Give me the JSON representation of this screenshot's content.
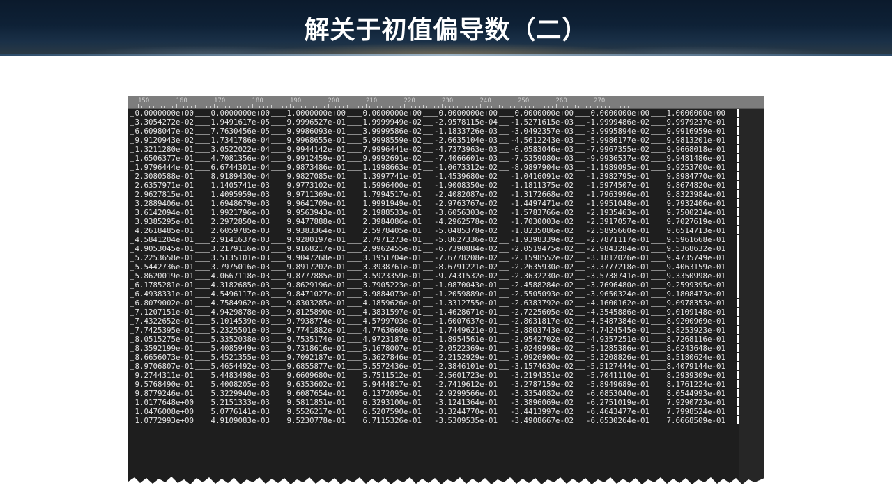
{
  "slide": {
    "title": "解关于初值偏导数（二）"
  },
  "ruler": {
    "ticks": [
      "150",
      "160",
      "170",
      "180",
      "190",
      "200",
      "210",
      "220",
      "230",
      "240",
      "250",
      "260",
      "270"
    ]
  },
  "editor": {
    "rows": [
      [
        "0.0000000e+00",
        "0.0000000e+00",
        "1.0000000e+00",
        "0.0000000e+00",
        "0.0000000e+00",
        "0.0000000e+00",
        "0.0000000e+00",
        "1.0000000e+00"
      ],
      [
        "3.3054272e-02",
        "1.9491617e-05",
        "9.9996527e-01",
        "1.9999949e-02",
        "-2.9578115e-04",
        "-1.5271615e-03",
        "-1.9999486e-02",
        "9.9979237e-01"
      ],
      [
        "6.6098047e-02",
        "7.7630456e-05",
        "9.9986093e-01",
        "3.9999586e-02",
        "-1.1833726e-03",
        "-3.0492357e-03",
        "-3.9995894e-02",
        "9.9916959e-01"
      ],
      [
        "9.9120943e-02",
        "1.7341786e-04",
        "9.9968655e-01",
        "5.9998559e-02",
        "-2.6635104e-03",
        "-4.5612243e-03",
        "-5.9986177e-02",
        "9.9813201e-01"
      ],
      [
        "1.3211280e-01",
        "3.0522022e-04",
        "9.9944142e-01",
        "7.9996441e-02",
        "-4.7373963e-03",
        "-6.0583046e-03",
        "-7.9967355e-02",
        "9.9668018e-01"
      ],
      [
        "1.6506377e-01",
        "4.7081356e-04",
        "9.9912459e-01",
        "9.9992691e-02",
        "-7.4066601e-03",
        "-7.5359080e-03",
        "-9.9936537e-02",
        "9.9481486e-01"
      ],
      [
        "1.9796444e-01",
        "6.6744301e-04",
        "9.9873486e-01",
        "1.1998663e-01",
        "-1.0673312e-02",
        "-8.9897904e-03",
        "-1.1989095e-01",
        "9.9253700e-01"
      ],
      [
        "2.3080588e-01",
        "8.9189430e-04",
        "9.9827085e-01",
        "1.3997741e-01",
        "-1.4539680e-02",
        "-1.0416091e-02",
        "-1.3982795e-01",
        "9.8984770e-01"
      ],
      [
        "2.6357971e-01",
        "1.1405741e-03",
        "9.9773102e-01",
        "1.5996400e-01",
        "-1.9008350e-02",
        "-1.1811375e-02",
        "-1.5974507e-01",
        "9.8674820e-01"
      ],
      [
        "2.9627815e-01",
        "1.4095959e-03",
        "9.9711369e-01",
        "1.7994517e-01",
        "-2.4082087e-02",
        "-1.3172668e-02",
        "-1.7963996e-01",
        "9.8323984e-01"
      ],
      [
        "3.2889406e-01",
        "1.6948679e-03",
        "9.9641709e-01",
        "1.9991949e-01",
        "-2.9763767e-02",
        "-1.4497471e-02",
        "-1.9951048e-01",
        "9.7932406e-01"
      ],
      [
        "3.6142094e-01",
        "1.9921796e-03",
        "9.9563943e-01",
        "2.1988533e-01",
        "-3.6056303e-02",
        "-1.5783766e-02",
        "-2.1935463e-01",
        "9.7500234e-01"
      ],
      [
        "3.9385295e-01",
        "2.2972850e-03",
        "9.9477888e-01",
        "2.3984086e-01",
        "-4.2962578e-02",
        "-1.7030003e-02",
        "-2.3917057e-01",
        "9.7027619e-01"
      ],
      [
        "4.2618485e-01",
        "2.6059785e-03",
        "9.9383364e-01",
        "2.5978405e-01",
        "-5.0485378e-02",
        "-1.8235086e-02",
        "-2.5895660e-01",
        "9.6514713e-01"
      ],
      [
        "4.5841204e-01",
        "2.9141637e-03",
        "9.9280197e-01",
        "2.7971273e-01",
        "-5.8627336e-02",
        "-1.9398339e-02",
        "-2.7871117e-01",
        "9.5961668e-01"
      ],
      [
        "4.9053045e-01",
        "3.2179116e-03",
        "9.9168217e-01",
        "2.9962455e-01",
        "-6.7390884e-02",
        "-2.0519475e-02",
        "-2.9843284e-01",
        "9.5368632e-01"
      ],
      [
        "5.2253658e-01",
        "3.5135101e-03",
        "9.9047268e-01",
        "3.1951704e-01",
        "-7.6778208e-02",
        "-2.1598552e-02",
        "-3.1812026e-01",
        "9.4735749e-01"
      ],
      [
        "5.5442736e-01",
        "3.7975016e-03",
        "9.8917202e-01",
        "3.3938761e-01",
        "-8.6791221e-02",
        "-2.2635930e-02",
        "-3.3777218e-01",
        "9.4063159e-01"
      ],
      [
        "5.8620019e-01",
        "4.0667118e-03",
        "9.8777885e-01",
        "3.5923359e-01",
        "-9.7431532e-02",
        "-2.3632230e-02",
        "-3.5738741e-01",
        "9.3350998e-01"
      ],
      [
        "6.1785281e-01",
        "4.3182685e-03",
        "9.8629196e-01",
        "3.7905223e-01",
        "-1.0870043e-01",
        "-2.4588284e-02",
        "-3.7696480e-01",
        "9.2599395e-01"
      ],
      [
        "6.4938331e-01",
        "4.5496117e-03",
        "9.8471027e-01",
        "3.9884073e-01",
        "-1.2059889e-01",
        "-2.5505093e-02",
        "-3.9650324e-01",
        "9.1808473e-01"
      ],
      [
        "6.8079002e-01",
        "4.7584962e-03",
        "9.8303285e-01",
        "4.1859626e-01",
        "-1.3312755e-01",
        "-2.6383792e-02",
        "-4.1600162e-01",
        "9.0978353e-01"
      ],
      [
        "7.1207151e-01",
        "4.9429878e-03",
        "9.8125890e-01",
        "4.3831597e-01",
        "-1.4628671e-01",
        "-2.7225605e-02",
        "-4.3545886e-01",
        "9.0109148e-01"
      ],
      [
        "7.4322652e-01",
        "5.1014539e-03",
        "9.7938774e-01",
        "4.5799703e-01",
        "-1.6007637e-01",
        "-2.8031817e-02",
        "-4.5487384e-01",
        "8.9200969e-01"
      ],
      [
        "7.7425395e-01",
        "5.2325501e-03",
        "9.7741882e-01",
        "4.7763660e-01",
        "-1.7449621e-01",
        "-2.8803743e-02",
        "-4.7424545e-01",
        "8.8253923e-01"
      ],
      [
        "8.0515275e-01",
        "5.3352038e-03",
        "9.7535174e-01",
        "4.9723187e-01",
        "-1.8954561e-01",
        "-2.9542702e-02",
        "-4.9357251e-01",
        "8.7268116e-01"
      ],
      [
        "8.3592199e-01",
        "5.4085949e-03",
        "9.7318616e-01",
        "5.1678007e-01",
        "-2.0522369e-01",
        "-3.0249998e-02",
        "-5.1285386e-01",
        "8.6243648e-01"
      ],
      [
        "8.6656073e-01",
        "5.4521355e-03",
        "9.7092187e-01",
        "5.3627846e-01",
        "-2.2152929e-01",
        "-3.0926900e-02",
        "-5.3208826e-01",
        "8.5180624e-01"
      ],
      [
        "8.9706807e-01",
        "5.4654492e-03",
        "9.6855877e-01",
        "5.5572436e-01",
        "-2.3846101e-01",
        "-3.1574630e-02",
        "-5.5127444e-01",
        "8.4079144e-01"
      ],
      [
        "9.2744311e-01",
        "5.4483498e-03",
        "9.6609680e-01",
        "5.7511512e-01",
        "-2.5601723e-01",
        "-3.2194351e-02",
        "-5.7041110e-01",
        "8.2939309e-01"
      ],
      [
        "9.5768490e-01",
        "5.4008205e-03",
        "9.6353602e-01",
        "5.9444817e-01",
        "-2.7419612e-01",
        "-3.2787159e-02",
        "-5.8949689e-01",
        "8.1761224e-01"
      ],
      [
        "9.8779246e-01",
        "5.3229940e-03",
        "9.6087654e-01",
        "6.1372095e-01",
        "-2.9299566e-01",
        "-3.3354082e-02",
        "-6.0853040e-01",
        "8.0544993e-01"
      ],
      [
        "1.0177648e+00",
        "5.2151333e-03",
        "9.5811851e-01",
        "6.3293100e-01",
        "-3.1241364e-01",
        "-3.3896069e-02",
        "-6.2751019e-01",
        "7.9290723e-01"
      ],
      [
        "1.0476008e+00",
        "5.0776141e-03",
        "9.5526217e-01",
        "6.5207590e-01",
        "-3.3244770e-01",
        "-3.4413997e-02",
        "-6.4643477e-01",
        "7.7998524e-01"
      ],
      [
        "1.0772993e+00",
        "4.9109083e-03",
        "9.5230778e-01",
        "6.7115326e-01",
        "-3.5309535e-01",
        "-3.4908667e-02",
        "-6.6530264e-01",
        "7.6668509e-01"
      ]
    ]
  }
}
